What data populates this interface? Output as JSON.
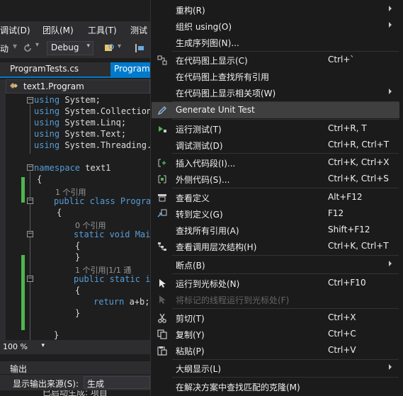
{
  "menubar": {
    "items": [
      "调试(D)",
      "团队(M)",
      "工具(T)",
      "测试"
    ]
  },
  "toolbar": {
    "left_label": "动",
    "config": "Debug"
  },
  "tabs": [
    {
      "label": "ProgramTests.cs"
    },
    {
      "label": "Program"
    }
  ],
  "nav": {
    "scope": "text1.Program"
  },
  "code": {
    "usings": [
      "System;",
      "System.Collection",
      "System.Linq;",
      "System.Text;",
      "System.Threading."
    ],
    "ns_kw": "namespace",
    "ns_name": "text1",
    "brace_open": "{",
    "brace_close": "}",
    "ref1": "1 个引用",
    "class_decl": "public class Progra",
    "ref0": "0 个引用",
    "main_decl": "static void Mai",
    "ref2": "1 个引用|1/1 通",
    "add_decl": "public static i",
    "return_kw": "return",
    "return_expr": "a+b;"
  },
  "status": {
    "zoom": "100 %"
  },
  "output": {
    "title": "输出",
    "source_label": "显示输出来源(S):",
    "source_value": "生成",
    "last_line": "已启动生成: 项目"
  },
  "context_menu": {
    "items": [
      {
        "label": "重构(R)",
        "shortcut": "",
        "submenu": true,
        "icon": ""
      },
      {
        "label": "组织 using(O)",
        "shortcut": "",
        "submenu": true,
        "icon": ""
      },
      {
        "label": "生成序列图(N)...",
        "shortcut": "",
        "submenu": false,
        "icon": ""
      },
      {
        "label": "在代码图上显示(C)",
        "shortcut": "Ctrl+`",
        "submenu": false,
        "icon": "code-map-icon"
      },
      {
        "label": "在代码图上查找所有引用",
        "shortcut": "",
        "submenu": false,
        "icon": ""
      },
      {
        "label": "在代码图上显示相关项(W)",
        "shortcut": "",
        "submenu": true,
        "icon": ""
      },
      {
        "label": "Generate Unit Test",
        "shortcut": "",
        "submenu": false,
        "icon": "pencil-icon",
        "highlighted": true
      },
      {
        "label": "运行测试(T)",
        "shortcut": "Ctrl+R, T",
        "submenu": false,
        "icon": "run-tests-icon"
      },
      {
        "label": "调试测试(D)",
        "shortcut": "Ctrl+R, Ctrl+T",
        "submenu": false,
        "icon": ""
      },
      {
        "label": "插入代码段(I)...",
        "shortcut": "Ctrl+K, Ctrl+X",
        "submenu": false,
        "icon": "insert-snippet-icon"
      },
      {
        "label": "外侧代码(S)...",
        "shortcut": "Ctrl+K, Ctrl+S",
        "submenu": false,
        "icon": "surround-with-icon"
      },
      {
        "label": "查看定义",
        "shortcut": "Alt+F12",
        "submenu": false,
        "icon": "peek-definition-icon"
      },
      {
        "label": "转到定义(G)",
        "shortcut": "F12",
        "submenu": false,
        "icon": "go-to-definition-icon"
      },
      {
        "label": "查找所有引用(A)",
        "shortcut": "Shift+F12",
        "submenu": false,
        "icon": ""
      },
      {
        "label": "查看调用层次结构(H)",
        "shortcut": "Ctrl+K, Ctrl+T",
        "submenu": false,
        "icon": "call-hierarchy-icon"
      },
      {
        "label": "断点(B)",
        "shortcut": "",
        "submenu": true,
        "icon": ""
      },
      {
        "label": "运行到光标处(N)",
        "shortcut": "Ctrl+F10",
        "submenu": false,
        "icon": "run-to-cursor-icon"
      },
      {
        "label": "将标记的线程运行到光标处(F)",
        "shortcut": "",
        "submenu": false,
        "icon": "run-flagged-threads-icon",
        "disabled": true
      },
      {
        "label": "剪切(T)",
        "shortcut": "Ctrl+X",
        "submenu": false,
        "icon": "scissors-icon"
      },
      {
        "label": "复制(Y)",
        "shortcut": "Ctrl+C",
        "submenu": false,
        "icon": "copy-icon"
      },
      {
        "label": "粘贴(P)",
        "shortcut": "Ctrl+V",
        "submenu": false,
        "icon": "paste-icon"
      },
      {
        "label": "大纲显示(L)",
        "shortcut": "",
        "submenu": true,
        "icon": ""
      },
      {
        "label": "在解决方案中查找匹配的克隆(M)",
        "shortcut": "",
        "submenu": false,
        "icon": ""
      }
    ]
  }
}
